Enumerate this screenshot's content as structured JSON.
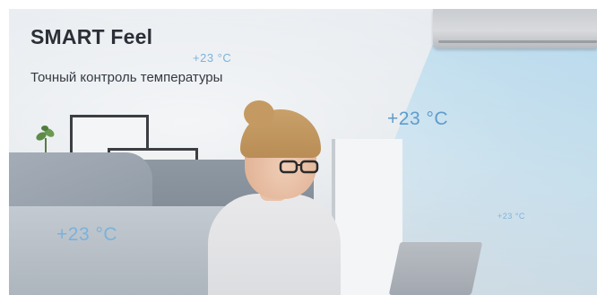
{
  "banner": {
    "title": "SMART Feel",
    "subtitle": "Точный контроль температуры"
  },
  "temperatures": [
    "+23 °C",
    "+23 °C",
    "+23 °C",
    "+23 °C"
  ],
  "colors": {
    "temperature_text": "#6fa9d4",
    "title_text": "#2b2f36",
    "airflow": "#a6d6f0",
    "background": "#e6eaee"
  }
}
